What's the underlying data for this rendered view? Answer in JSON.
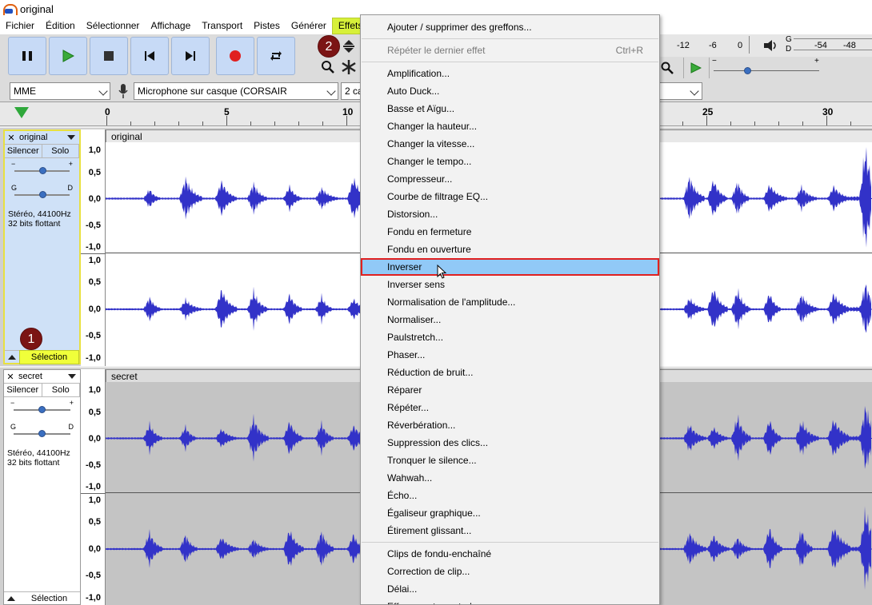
{
  "window": {
    "title": "original"
  },
  "menubar": [
    "Fichier",
    "Édition",
    "Sélectionner",
    "Affichage",
    "Transport",
    "Pistes",
    "Générer",
    "Effets"
  ],
  "active_menu": "Effets",
  "devices": {
    "host": "MME",
    "input": "Microphone sur casque (CORSAIR",
    "channels": "2 ca"
  },
  "meter": {
    "labels": [
      "-12",
      "-6",
      "0",
      "-54",
      "-48"
    ],
    "lr_top": "G",
    "lr_bottom": "D"
  },
  "ruler": {
    "labels": [
      "0",
      "5",
      "10",
      "25",
      "30"
    ]
  },
  "badges": {
    "one": "1",
    "two": "2"
  },
  "tracks": [
    {
      "name": "original",
      "clip_name": "original",
      "mute": "Silencer",
      "solo": "Solo",
      "gain_minus": "−",
      "gain_plus": "+",
      "pan_left": "G",
      "pan_right": "D",
      "info_line1": "Stéréo, 44100Hz",
      "info_line2": "32 bits flottant",
      "select_label": "Sélection",
      "vruler": [
        "1,0",
        "0,5",
        "0,0",
        "-0,5",
        "-1,0"
      ]
    },
    {
      "name": "secret",
      "clip_name": "secret",
      "mute": "Silencer",
      "solo": "Solo",
      "gain_minus": "−",
      "gain_plus": "+",
      "pan_left": "G",
      "pan_right": "D",
      "info_line1": "Stéréo, 44100Hz",
      "info_line2": "32 bits flottant",
      "select_label": "Sélection",
      "vruler": [
        "1,0",
        "0,5",
        "0,0",
        "-0,5",
        "-1,0"
      ]
    }
  ],
  "effects_menu": {
    "items": [
      {
        "label": "Ajouter / supprimer des greffons...",
        "state": "normal",
        "sep_after": true
      },
      {
        "label": "Répéter le dernier effet",
        "shortcut": "Ctrl+R",
        "state": "disabled",
        "sep_after": true
      },
      {
        "label": "Amplification...",
        "state": "normal"
      },
      {
        "label": "Auto Duck...",
        "state": "normal"
      },
      {
        "label": "Basse et Aïgu...",
        "state": "normal"
      },
      {
        "label": "Changer la hauteur...",
        "state": "normal"
      },
      {
        "label": "Changer la vitesse...",
        "state": "normal"
      },
      {
        "label": "Changer le tempo...",
        "state": "normal"
      },
      {
        "label": "Compresseur...",
        "state": "normal"
      },
      {
        "label": "Courbe de filtrage EQ...",
        "state": "normal"
      },
      {
        "label": "Distorsion...",
        "state": "normal"
      },
      {
        "label": "Fondu en fermeture",
        "state": "normal"
      },
      {
        "label": "Fondu en ouverture",
        "state": "normal"
      },
      {
        "label": "Inverser",
        "state": "hover"
      },
      {
        "label": "Inverser sens",
        "state": "normal"
      },
      {
        "label": "Normalisation de l'amplitude...",
        "state": "normal"
      },
      {
        "label": "Normaliser...",
        "state": "normal"
      },
      {
        "label": "Paulstretch...",
        "state": "normal"
      },
      {
        "label": "Phaser...",
        "state": "normal"
      },
      {
        "label": "Réduction de bruit...",
        "state": "normal"
      },
      {
        "label": "Réparer",
        "state": "normal"
      },
      {
        "label": "Répéter...",
        "state": "normal"
      },
      {
        "label": "Réverbération...",
        "state": "normal"
      },
      {
        "label": "Suppression des clics...",
        "state": "normal"
      },
      {
        "label": "Tronquer le silence...",
        "state": "normal"
      },
      {
        "label": "Wahwah...",
        "state": "normal"
      },
      {
        "label": "Écho...",
        "state": "normal"
      },
      {
        "label": "Égaliseur graphique...",
        "state": "normal"
      },
      {
        "label": "Étirement glissant...",
        "state": "normal",
        "sep_after": true
      },
      {
        "label": "Clips de fondu-enchaîné",
        "state": "normal"
      },
      {
        "label": "Correction de clip...",
        "state": "normal"
      },
      {
        "label": "Délai...",
        "state": "normal"
      },
      {
        "label": "Effacement spectral",
        "state": "normal"
      }
    ]
  },
  "colors": {
    "waveform": "#3232c8",
    "selected_track": "#cfe1f7",
    "menu_highlight": "#91c9f7",
    "highlight_border": "#e02020",
    "menu_active": "#d7f039"
  }
}
